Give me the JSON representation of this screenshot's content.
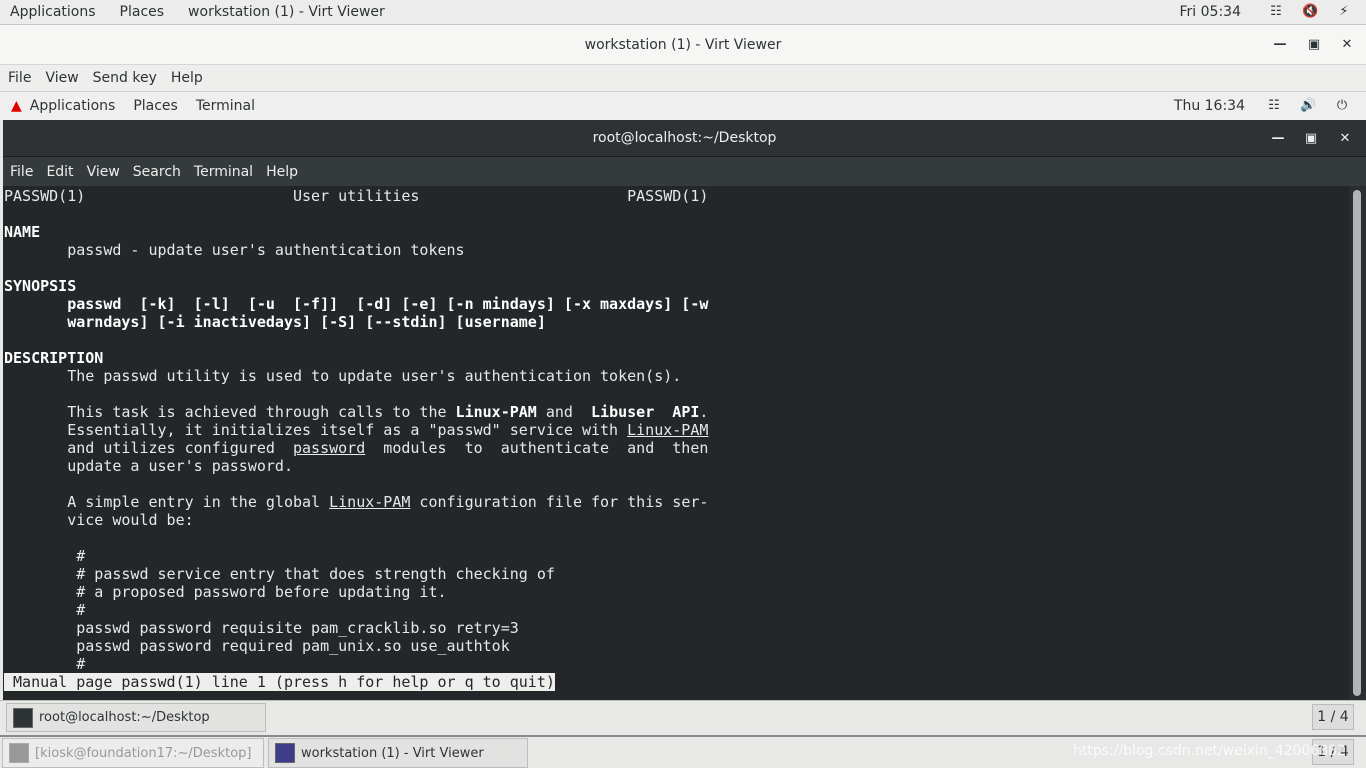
{
  "host_topbar": {
    "applications": "Applications",
    "places": "Places",
    "active_app": "workstation (1) - Virt Viewer",
    "clock": "Fri 05:34",
    "icons": [
      "network-icon",
      "volume-muted-icon",
      "battery-charging-icon"
    ]
  },
  "viewer": {
    "title": "workstation (1) - Virt Viewer",
    "menu": [
      "File",
      "View",
      "Send key",
      "Help"
    ]
  },
  "guest_topbar": {
    "applications": "Applications",
    "places": "Places",
    "active_app": "Terminal",
    "clock": "Thu 16:34",
    "icons": [
      "network-icon",
      "volume-icon",
      "power-icon"
    ],
    "logo_color": "#e00000"
  },
  "terminal": {
    "title": "root@localhost:~/Desktop",
    "menu": [
      "File",
      "Edit",
      "View",
      "Search",
      "Terminal",
      "Help"
    ],
    "lines": [
      [
        [
          "PASSWD(1)                       User utilities                       PASSWD(1)",
          "n"
        ]
      ],
      [],
      [
        [
          "NAME",
          "b"
        ]
      ],
      [
        [
          "       passwd - update user's authentication tokens",
          "n"
        ]
      ],
      [],
      [
        [
          "SYNOPSIS",
          "b"
        ]
      ],
      [
        [
          "       passwd  [-k]  [-l]  [-u  [-f]]  [-d] [-e] [-n mindays] [-x maxdays] [-w",
          "b"
        ]
      ],
      [
        [
          "       warndays] [-i inactivedays] [-S] [--stdin] [username]",
          "b"
        ]
      ],
      [],
      [
        [
          "DESCRIPTION",
          "b"
        ]
      ],
      [
        [
          "       The passwd utility is used to update user's authentication token(s).",
          "n"
        ]
      ],
      [],
      [
        [
          "       This task is achieved through calls to the ",
          "n"
        ],
        [
          "Linux-PAM",
          "b"
        ],
        [
          " and  ",
          "n"
        ],
        [
          "Libuser  API",
          "b"
        ],
        [
          ".",
          "n"
        ]
      ],
      [
        [
          "       Essentially, it initializes itself as a \"passwd\" service with ",
          "n"
        ],
        [
          "Linux-PAM",
          "u"
        ]
      ],
      [
        [
          "       and utilizes configured  ",
          "n"
        ],
        [
          "password",
          "u"
        ],
        [
          "  modules  to  authenticate  and  then",
          "n"
        ]
      ],
      [
        [
          "       update a user's password.",
          "n"
        ]
      ],
      [],
      [
        [
          "       A simple entry in the global ",
          "n"
        ],
        [
          "Linux-PAM",
          "u"
        ],
        [
          " configuration file for this ser-",
          "n"
        ]
      ],
      [
        [
          "       vice would be:",
          "n"
        ]
      ],
      [],
      [
        [
          "        #",
          "n"
        ]
      ],
      [
        [
          "        # passwd service entry that does strength checking of",
          "n"
        ]
      ],
      [
        [
          "        # a proposed password before updating it.",
          "n"
        ]
      ],
      [
        [
          "        #",
          "n"
        ]
      ],
      [
        [
          "        passwd password requisite pam_cracklib.so retry=3",
          "n"
        ]
      ],
      [
        [
          "        passwd password required pam_unix.so use_authtok",
          "n"
        ]
      ],
      [
        [
          "        #",
          "n"
        ]
      ],
      [
        [
          " Manual page passwd(1) line 1 (press h for help or q to quit)",
          "inv"
        ]
      ]
    ]
  },
  "guest_taskbar": {
    "window": "root@localhost:~/Desktop",
    "pager": "1 / 4"
  },
  "host_taskbar": {
    "windows": [
      "[kiosk@foundation17:~/Desktop]",
      "workstation (1) - Virt Viewer"
    ],
    "pager": "1 / 4",
    "watermark": "https://blog.csdn.net/weixin_42006882"
  }
}
